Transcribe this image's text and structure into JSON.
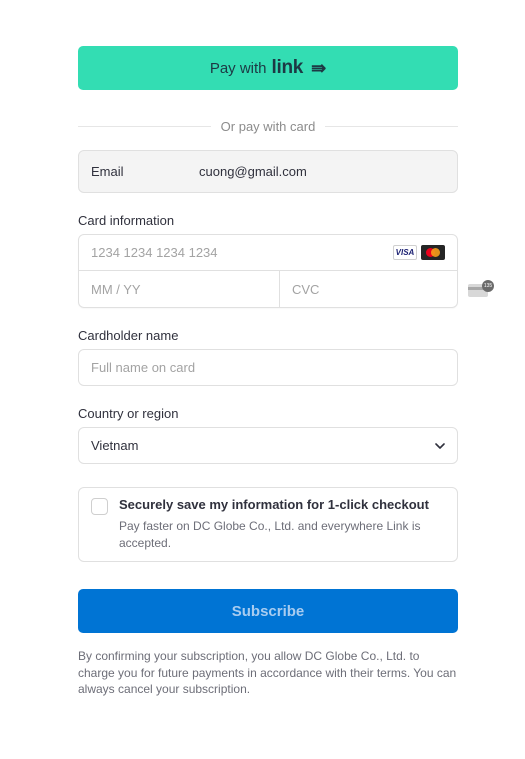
{
  "link_button": {
    "prefix": "Pay with",
    "logo": "link",
    "arrow_icon": "double-arrow-right-icon",
    "color": "#33ddb3"
  },
  "divider": {
    "label": "Or pay with card"
  },
  "email": {
    "label": "Email",
    "value": "cuong@gmail.com"
  },
  "card_info": {
    "label": "Card information",
    "number_placeholder": "1234 1234 1234 1234",
    "expiry_placeholder": "MM / YY",
    "cvc_placeholder": "CVC",
    "brands": [
      "VISA",
      "mastercard"
    ],
    "cvc_badge": "135"
  },
  "cardholder": {
    "label": "Cardholder name",
    "placeholder": "Full name on card"
  },
  "country": {
    "label": "Country or region",
    "selected": "Vietnam"
  },
  "save_info": {
    "title": "Securely save my information for 1-click checkout",
    "description": "Pay faster on DC Globe Co., Ltd. and everywhere Link is accepted.",
    "checked": false
  },
  "subscribe": {
    "label": "Subscribe",
    "color": "#0074d4"
  },
  "terms": "By confirming your subscription, you allow DC Globe Co., Ltd. to charge you for future payments in accordance with their terms. You can always cancel your subscription."
}
